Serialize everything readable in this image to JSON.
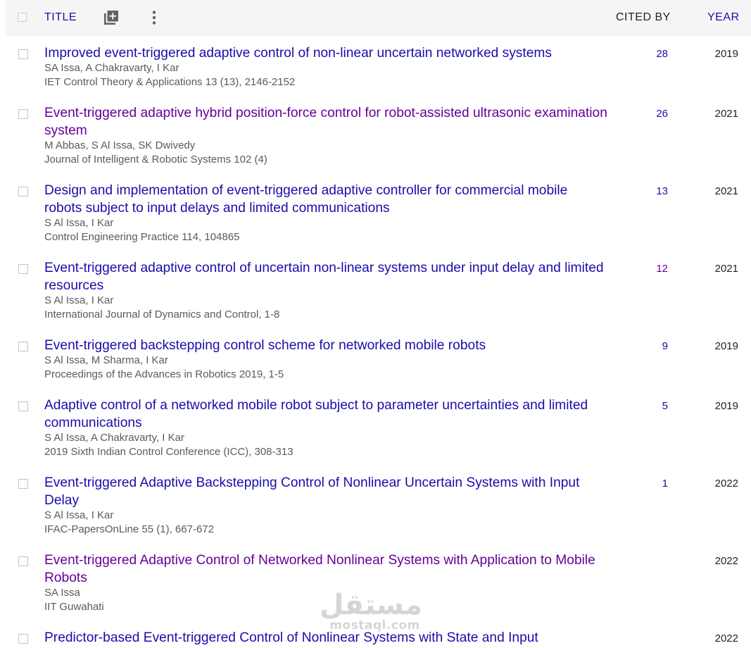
{
  "header": {
    "title_label": "TITLE",
    "cited_label": "CITED BY",
    "year_label": "YEAR",
    "add_icon": "add-box-icon",
    "more_icon": "more-vert-icon"
  },
  "rows": [
    {
      "title": "Improved event-triggered adaptive control of non-linear uncertain networked systems",
      "authors": "SA Issa, A Chakravarty, I Kar",
      "venue": "IET Control Theory & Applications 13 (13), 2146-2152",
      "cited": "28",
      "year": "2019",
      "visited": false
    },
    {
      "title": "Event-triggered adaptive hybrid position-force control for robot-assisted ultrasonic examination system",
      "authors": "M Abbas, S Al Issa, SK Dwivedy",
      "venue": "Journal of Intelligent & Robotic Systems 102 (4)",
      "cited": "26",
      "year": "2021",
      "visited": true
    },
    {
      "title": "Design and implementation of event-triggered adaptive controller for commercial mobile robots subject to input delays and limited communications",
      "authors": "S Al Issa, I Kar",
      "venue": "Control Engineering Practice 114, 104865",
      "cited": "13",
      "year": "2021",
      "visited": false
    },
    {
      "title": "Event-triggered adaptive control of uncertain non-linear systems under input delay and limited resources",
      "authors": "S Al Issa, I Kar",
      "venue": "International Journal of Dynamics and Control, 1-8",
      "cited": "12",
      "year": "2021",
      "visited": false
    },
    {
      "title": "Event-triggered backstepping control scheme for networked mobile robots",
      "authors": "S Al Issa, M Sharma, I Kar",
      "venue": "Proceedings of the Advances in Robotics 2019, 1-5",
      "cited": "9",
      "year": "2019",
      "visited": false
    },
    {
      "title": "Adaptive control of a networked mobile robot subject to parameter uncertainties and limited communications",
      "authors": "S Al Issa, A Chakravarty, I Kar",
      "venue": "2019 Sixth Indian Control Conference (ICC), 308-313",
      "cited": "5",
      "year": "2019",
      "visited": false
    },
    {
      "title": "Event-triggered Adaptive Backstepping Control of Nonlinear Uncertain Systems with Input Delay",
      "authors": "S Al Issa, I Kar",
      "venue": "IFAC-PapersOnLine 55 (1), 667-672",
      "cited": "1",
      "year": "2022",
      "visited": false
    },
    {
      "title": "Event-triggered Adaptive Control of Networked Nonlinear Systems with Application to Mobile Robots",
      "authors": "SA Issa",
      "venue": "IIT Guwahati",
      "cited": "",
      "year": "2022",
      "visited": true
    },
    {
      "title": "Predictor-based Event-triggered Control of Nonlinear Systems with State and Input",
      "authors": "",
      "venue": "",
      "cited": "",
      "year": "2022",
      "visited": false
    }
  ],
  "watermark": {
    "arabic": "مستقل",
    "latin": "mostaql.com"
  },
  "colors": {
    "link": "#1a0dab",
    "visited_link": "#660099",
    "meta_text": "#5a5a5a",
    "header_bg": "#f5f5f5"
  }
}
